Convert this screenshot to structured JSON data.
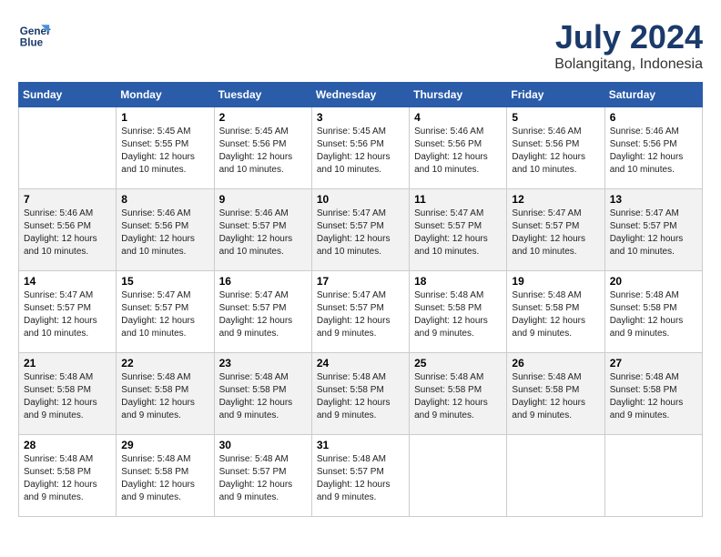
{
  "header": {
    "logo_line1": "General",
    "logo_line2": "Blue",
    "month": "July 2024",
    "location": "Bolangitang, Indonesia"
  },
  "weekdays": [
    "Sunday",
    "Monday",
    "Tuesday",
    "Wednesday",
    "Thursday",
    "Friday",
    "Saturday"
  ],
  "weeks": [
    [
      {
        "day": "",
        "info": ""
      },
      {
        "day": "1",
        "info": "Sunrise: 5:45 AM\nSunset: 5:55 PM\nDaylight: 12 hours\nand 10 minutes."
      },
      {
        "day": "2",
        "info": "Sunrise: 5:45 AM\nSunset: 5:56 PM\nDaylight: 12 hours\nand 10 minutes."
      },
      {
        "day": "3",
        "info": "Sunrise: 5:45 AM\nSunset: 5:56 PM\nDaylight: 12 hours\nand 10 minutes."
      },
      {
        "day": "4",
        "info": "Sunrise: 5:46 AM\nSunset: 5:56 PM\nDaylight: 12 hours\nand 10 minutes."
      },
      {
        "day": "5",
        "info": "Sunrise: 5:46 AM\nSunset: 5:56 PM\nDaylight: 12 hours\nand 10 minutes."
      },
      {
        "day": "6",
        "info": "Sunrise: 5:46 AM\nSunset: 5:56 PM\nDaylight: 12 hours\nand 10 minutes."
      }
    ],
    [
      {
        "day": "7",
        "info": "Sunrise: 5:46 AM\nSunset: 5:56 PM\nDaylight: 12 hours\nand 10 minutes."
      },
      {
        "day": "8",
        "info": "Sunrise: 5:46 AM\nSunset: 5:56 PM\nDaylight: 12 hours\nand 10 minutes."
      },
      {
        "day": "9",
        "info": "Sunrise: 5:46 AM\nSunset: 5:57 PM\nDaylight: 12 hours\nand 10 minutes."
      },
      {
        "day": "10",
        "info": "Sunrise: 5:47 AM\nSunset: 5:57 PM\nDaylight: 12 hours\nand 10 minutes."
      },
      {
        "day": "11",
        "info": "Sunrise: 5:47 AM\nSunset: 5:57 PM\nDaylight: 12 hours\nand 10 minutes."
      },
      {
        "day": "12",
        "info": "Sunrise: 5:47 AM\nSunset: 5:57 PM\nDaylight: 12 hours\nand 10 minutes."
      },
      {
        "day": "13",
        "info": "Sunrise: 5:47 AM\nSunset: 5:57 PM\nDaylight: 12 hours\nand 10 minutes."
      }
    ],
    [
      {
        "day": "14",
        "info": "Sunrise: 5:47 AM\nSunset: 5:57 PM\nDaylight: 12 hours\nand 10 minutes."
      },
      {
        "day": "15",
        "info": "Sunrise: 5:47 AM\nSunset: 5:57 PM\nDaylight: 12 hours\nand 10 minutes."
      },
      {
        "day": "16",
        "info": "Sunrise: 5:47 AM\nSunset: 5:57 PM\nDaylight: 12 hours\nand 9 minutes."
      },
      {
        "day": "17",
        "info": "Sunrise: 5:47 AM\nSunset: 5:57 PM\nDaylight: 12 hours\nand 9 minutes."
      },
      {
        "day": "18",
        "info": "Sunrise: 5:48 AM\nSunset: 5:58 PM\nDaylight: 12 hours\nand 9 minutes."
      },
      {
        "day": "19",
        "info": "Sunrise: 5:48 AM\nSunset: 5:58 PM\nDaylight: 12 hours\nand 9 minutes."
      },
      {
        "day": "20",
        "info": "Sunrise: 5:48 AM\nSunset: 5:58 PM\nDaylight: 12 hours\nand 9 minutes."
      }
    ],
    [
      {
        "day": "21",
        "info": "Sunrise: 5:48 AM\nSunset: 5:58 PM\nDaylight: 12 hours\nand 9 minutes."
      },
      {
        "day": "22",
        "info": "Sunrise: 5:48 AM\nSunset: 5:58 PM\nDaylight: 12 hours\nand 9 minutes."
      },
      {
        "day": "23",
        "info": "Sunrise: 5:48 AM\nSunset: 5:58 PM\nDaylight: 12 hours\nand 9 minutes."
      },
      {
        "day": "24",
        "info": "Sunrise: 5:48 AM\nSunset: 5:58 PM\nDaylight: 12 hours\nand 9 minutes."
      },
      {
        "day": "25",
        "info": "Sunrise: 5:48 AM\nSunset: 5:58 PM\nDaylight: 12 hours\nand 9 minutes."
      },
      {
        "day": "26",
        "info": "Sunrise: 5:48 AM\nSunset: 5:58 PM\nDaylight: 12 hours\nand 9 minutes."
      },
      {
        "day": "27",
        "info": "Sunrise: 5:48 AM\nSunset: 5:58 PM\nDaylight: 12 hours\nand 9 minutes."
      }
    ],
    [
      {
        "day": "28",
        "info": "Sunrise: 5:48 AM\nSunset: 5:58 PM\nDaylight: 12 hours\nand 9 minutes."
      },
      {
        "day": "29",
        "info": "Sunrise: 5:48 AM\nSunset: 5:58 PM\nDaylight: 12 hours\nand 9 minutes."
      },
      {
        "day": "30",
        "info": "Sunrise: 5:48 AM\nSunset: 5:57 PM\nDaylight: 12 hours\nand 9 minutes."
      },
      {
        "day": "31",
        "info": "Sunrise: 5:48 AM\nSunset: 5:57 PM\nDaylight: 12 hours\nand 9 minutes."
      },
      {
        "day": "",
        "info": ""
      },
      {
        "day": "",
        "info": ""
      },
      {
        "day": "",
        "info": ""
      }
    ]
  ]
}
